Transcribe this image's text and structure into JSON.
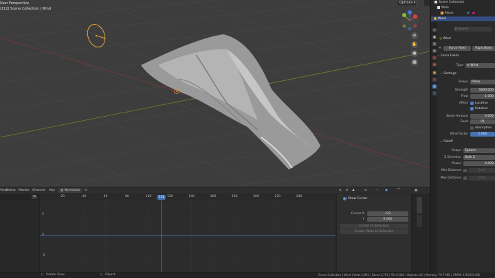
{
  "viewport": {
    "title": "User Perspective",
    "subtitle": "(112) Scene Collection | Wind",
    "options_label": "Options",
    "nav_buttons": [
      "zoom-icon",
      "hand-icon",
      "camera-icon",
      "grid-icon"
    ]
  },
  "outliner": {
    "rows": [
      {
        "label": "Scene Collection",
        "icon": "collection-icon"
      },
      {
        "label": "Main",
        "icon": "collection-icon"
      },
      {
        "label": "Plane",
        "icon": "mesh-icon"
      },
      {
        "label": "Wind",
        "icon": "forcefield-icon"
      }
    ]
  },
  "properties": {
    "search_placeholder": "Search",
    "object_name": "Wind",
    "buttons": [
      "Force Field",
      "Rigid Body"
    ],
    "panel_title": "Force Fields",
    "type_label": "Type",
    "type_value": "Wind",
    "settings": {
      "title": "Settings",
      "shape_label": "Shape",
      "shape_value": "Plane",
      "strength_label": "Strength",
      "strength_value": "5000.000",
      "flow_label": "Flow",
      "flow_value": "1.000",
      "affect_label": "Affect",
      "location_label": "Location",
      "rotation_label": "Rotation",
      "noise_label": "Noise Amount",
      "noise_value": "0.000",
      "seed_label": "Seed",
      "seed_value": "91",
      "absorption_label": "Absorption",
      "wind_factor_label": "Wind Factor",
      "wind_factor_value": "1.000"
    },
    "falloff": {
      "title": "Falloff",
      "shape_label": "Shape",
      "shape_value": "Sphere",
      "zdir_label": "Z Direction",
      "zdir_value": "Both Z",
      "power_label": "Power",
      "power_value": "0.000",
      "min_label": "Min Distance",
      "min_value": "0 m",
      "max_label": "Max Distance",
      "max_value": "0 m"
    }
  },
  "graph": {
    "menus": [
      "View",
      "Select",
      "Marker",
      "Channel",
      "Key"
    ],
    "normalize_label": "Normalize",
    "ticks": [
      "20",
      "40",
      "60",
      "80",
      "100",
      "120",
      "140",
      "160",
      "180",
      "200",
      "220",
      "240"
    ],
    "tick_values": [
      20,
      40,
      60,
      80,
      100,
      120,
      140,
      160,
      180,
      200,
      220,
      240
    ],
    "current_frame": "112",
    "current_frame_value": 112,
    "y_labels": [
      "5",
      "0",
      "-5"
    ],
    "sidebar": {
      "show_cursor": "Show Cursor",
      "cursor_x_label": "Cursor X",
      "cursor_x_value": "112",
      "cursor_y_label": "Y",
      "cursor_y_value": "0.000",
      "cursor_to_selection": "Cursor to Selection",
      "cursor_value_to_selection": "Cursor Value to Selection"
    }
  },
  "statusbar": {
    "left_hint": "Rotate View",
    "mid_hint": "Object",
    "stats": "Scene Collection | Wind | Verts:1,891 | Faces:1,792 | Tris:3,584 | Objects:1/2 | Memory: 79.7 MiB | VRAM: 2.9/24.0 GiB"
  },
  "colors": {
    "accent": "#4772b3",
    "selection": "#334d80",
    "viewport_bg": "#3d3d3d",
    "panel_bg": "#2b2b2b",
    "wind_ring": "#e8a33a"
  }
}
